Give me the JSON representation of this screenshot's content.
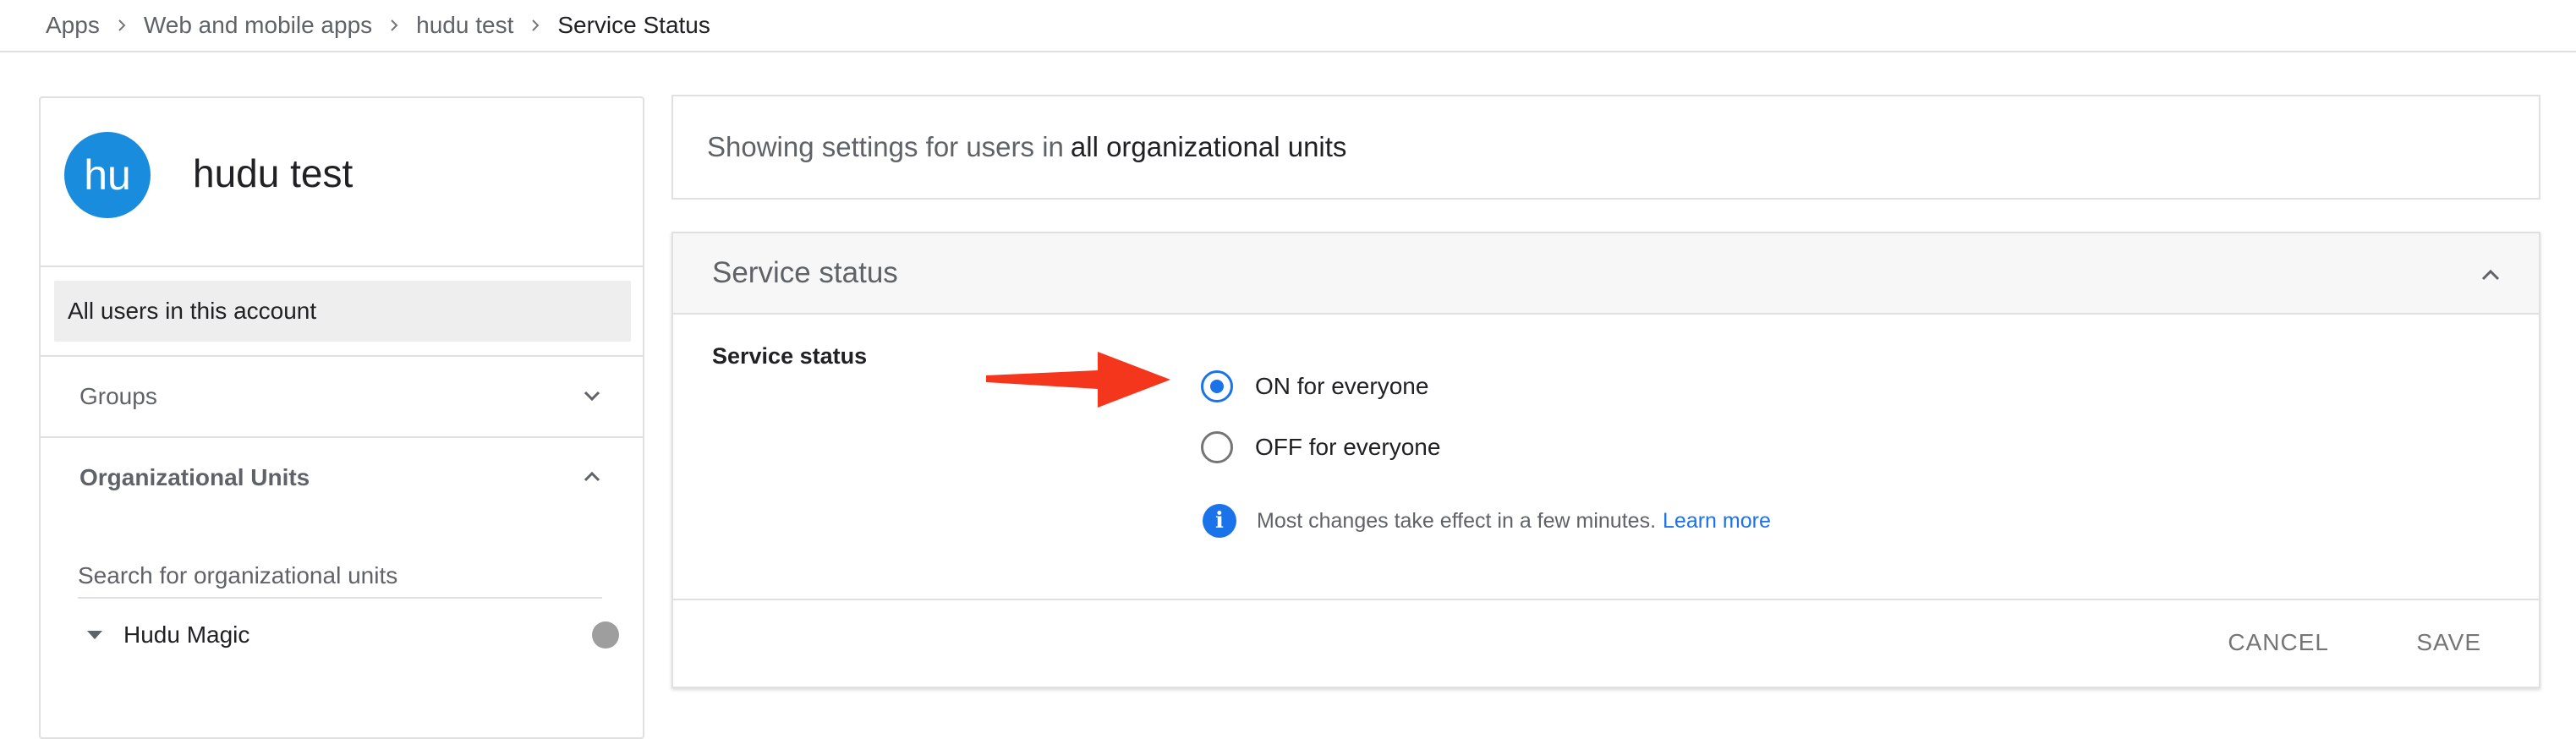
{
  "breadcrumb": {
    "items": [
      "Apps",
      "Web and mobile apps",
      "hudu test"
    ],
    "current": "Service Status"
  },
  "app": {
    "avatar_initials": "hu",
    "name": "hudu test",
    "avatar_color": "#1a8cde"
  },
  "sidebar": {
    "all_users": "All users in this account",
    "groups_label": "Groups",
    "ou_label": "Organizational Units",
    "ou_search_placeholder": "Search for organizational units",
    "ou_items": [
      {
        "name": "Hudu Magic"
      }
    ]
  },
  "banner": {
    "prefix": "Showing settings for users in",
    "scope": "all organizational units"
  },
  "card": {
    "title": "Service status",
    "setting_label": "Service status",
    "options": [
      {
        "label": "ON for everyone",
        "checked": true
      },
      {
        "label": "OFF for everyone",
        "checked": false
      }
    ],
    "info_text": "Most changes take effect in a few minutes.",
    "learn_more": "Learn more",
    "cancel_label": "CANCEL",
    "save_label": "SAVE"
  },
  "colors": {
    "accent": "#1a73e8",
    "annotation_arrow": "#f4361d"
  },
  "icons": {
    "breadcrumb_separator": "chevron-right-icon",
    "groups": "chevron-down-icon",
    "ou": "chevron-up-icon",
    "card_collapse": "chevron-up-icon",
    "ou_expand": "triangle-down-icon",
    "info": "info-icon"
  }
}
